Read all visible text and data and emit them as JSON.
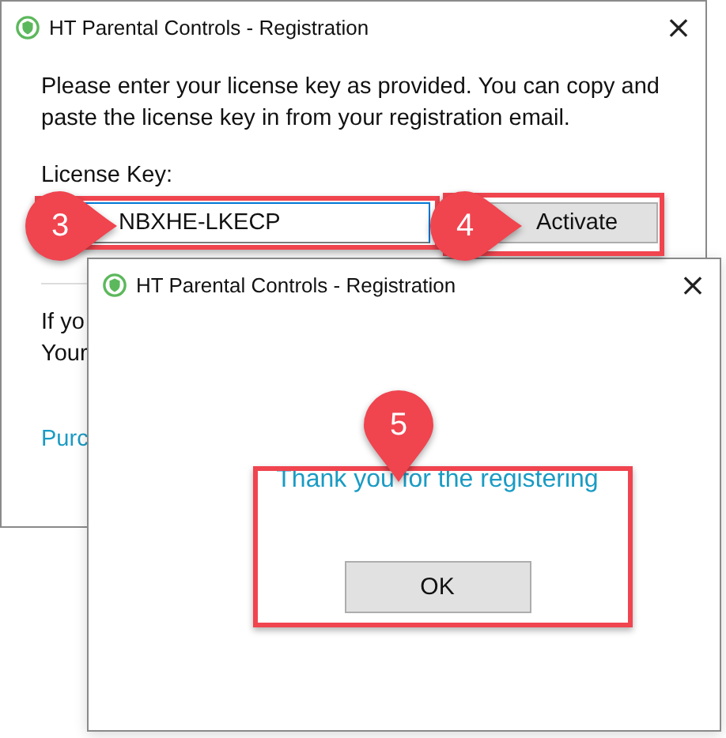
{
  "main_window": {
    "title": "HT Parental Controls - Registration",
    "close": "×",
    "intro": "Please enter your license key as provided. You can copy and paste the license key in from your registration email.",
    "key_label": "License Key:",
    "key_value": "NBXHE-LKECP",
    "activate_button": "Activate",
    "partial_lines": [
      "If yo",
      "Your"
    ],
    "link": "Purc"
  },
  "dialog": {
    "title": "HT Parental Controls - Registration",
    "close": "×",
    "message": "Thank you for the registering",
    "ok_button": "OK"
  },
  "callouts": [
    {
      "number": "3"
    },
    {
      "number": "4"
    },
    {
      "number": "5"
    }
  ]
}
